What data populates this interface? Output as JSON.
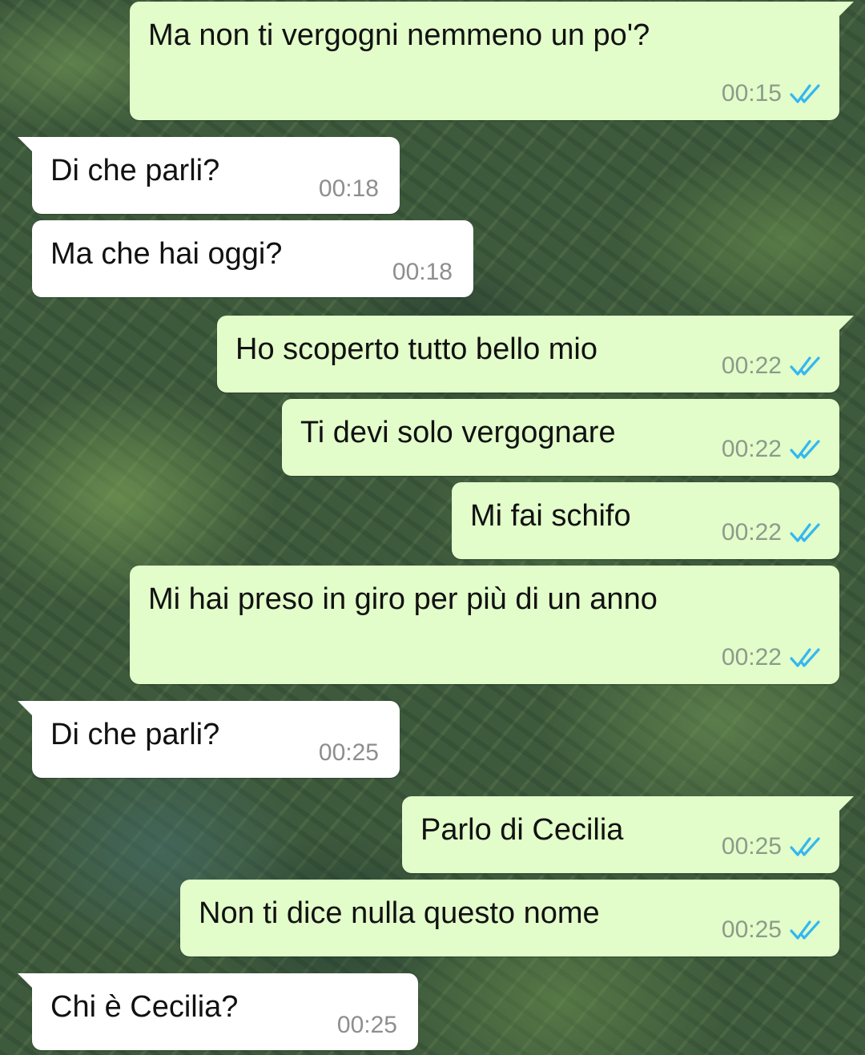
{
  "colors": {
    "outgoing_bubble": "#e2fdca",
    "incoming_bubble": "#ffffff",
    "read_ticks": "#34b7f1",
    "timestamp": "#8d9a8a"
  },
  "messages": [
    {
      "direction": "outgoing",
      "text": "Ma non ti vergogni nemmeno un po'?",
      "time": "00:15",
      "status_icon": "double-check-read-icon"
    },
    {
      "direction": "incoming",
      "text": "Di che parli?",
      "time": "00:18"
    },
    {
      "direction": "incoming",
      "text": "Ma che hai oggi?",
      "time": "00:18"
    },
    {
      "direction": "outgoing",
      "text": "Ho scoperto tutto bello mio",
      "time": "00:22",
      "status_icon": "double-check-read-icon"
    },
    {
      "direction": "outgoing",
      "text": "Ti devi solo vergognare",
      "time": "00:22",
      "status_icon": "double-check-read-icon"
    },
    {
      "direction": "outgoing",
      "text": "Mi fai schifo",
      "time": "00:22",
      "status_icon": "double-check-read-icon"
    },
    {
      "direction": "outgoing",
      "text": "Mi hai preso in giro per più di un anno",
      "time": "00:22",
      "status_icon": "double-check-read-icon"
    },
    {
      "direction": "incoming",
      "text": "Di che parli?",
      "time": "00:25"
    },
    {
      "direction": "outgoing",
      "text": "Parlo di Cecilia",
      "time": "00:25",
      "status_icon": "double-check-read-icon"
    },
    {
      "direction": "outgoing",
      "text": "Non ti dice nulla questo nome",
      "time": "00:25",
      "status_icon": "double-check-read-icon"
    },
    {
      "direction": "incoming",
      "text": "Chi è Cecilia?",
      "time": "00:25"
    }
  ]
}
